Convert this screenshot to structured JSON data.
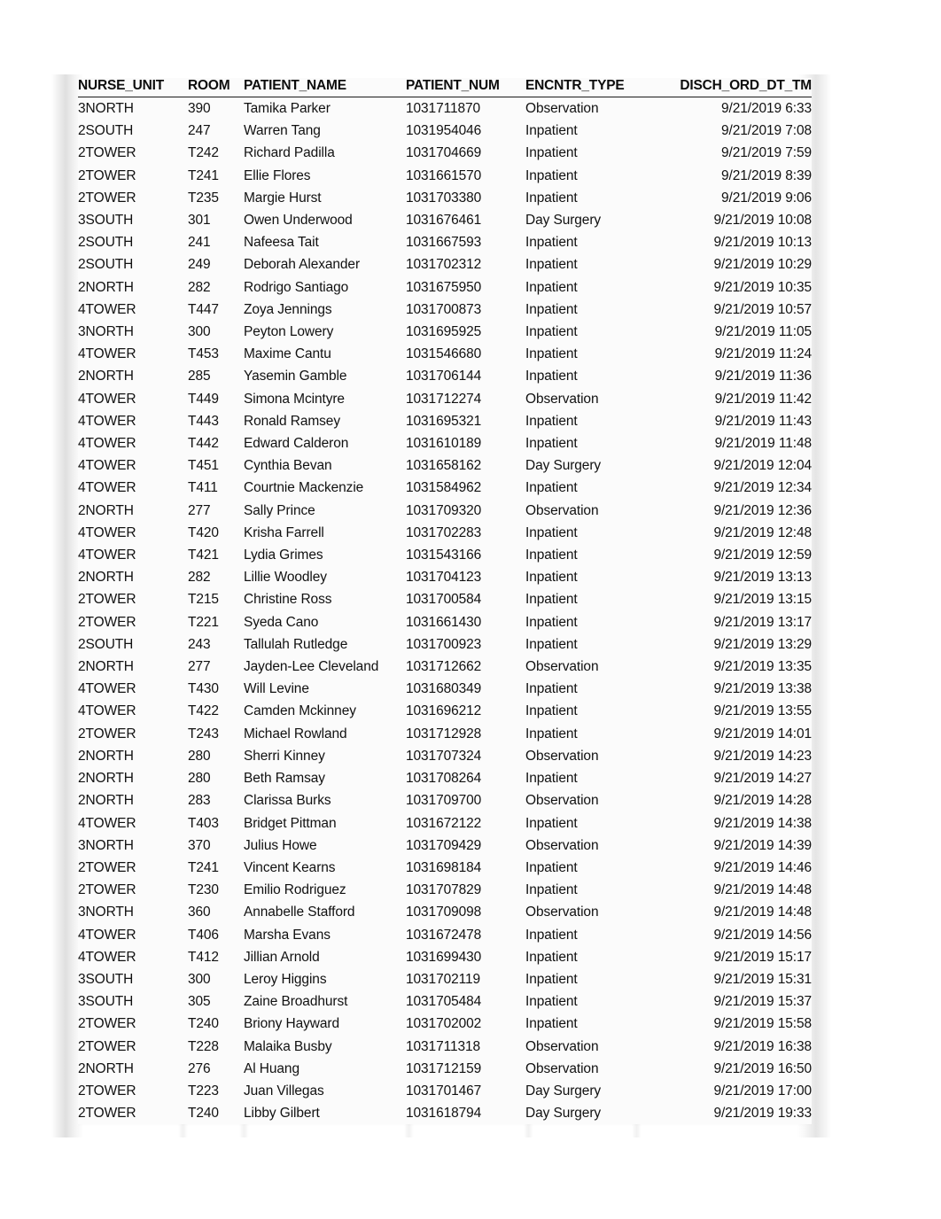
{
  "document": {
    "type": "spreadsheet-data-range",
    "colors": {
      "page_background": "#ffffff",
      "range_background": "#fbfbfb",
      "text": "#111111",
      "header_text": "#0d0d0d",
      "header_rule": "#1a1a1a"
    }
  },
  "table": {
    "columns": [
      {
        "key": "nurse_unit",
        "label": "NURSE_UNIT",
        "align": "left"
      },
      {
        "key": "room",
        "label": "ROOM",
        "align": "left"
      },
      {
        "key": "patient_name",
        "label": "PATIENT_NAME",
        "align": "left"
      },
      {
        "key": "patient_num",
        "label": "PATIENT_NUM",
        "align": "left"
      },
      {
        "key": "encntr_type",
        "label": "ENCNTR_TYPE",
        "align": "left"
      },
      {
        "key": "disch_ord",
        "label": "DISCH_ORD_DT_TM",
        "align": "right"
      }
    ],
    "row_count": 46,
    "rows": [
      {
        "nurse_unit": "3NORTH",
        "room": "390",
        "patient_name": "Tamika Parker",
        "patient_num": "1031711870",
        "encntr_type": "Observation",
        "disch_ord": "9/21/2019 6:33"
      },
      {
        "nurse_unit": "2SOUTH",
        "room": "247",
        "patient_name": "Warren Tang",
        "patient_num": "1031954046",
        "encntr_type": "Inpatient",
        "disch_ord": "9/21/2019 7:08"
      },
      {
        "nurse_unit": "2TOWER",
        "room": "T242",
        "patient_name": "Richard Padilla",
        "patient_num": "1031704669",
        "encntr_type": "Inpatient",
        "disch_ord": "9/21/2019 7:59"
      },
      {
        "nurse_unit": "2TOWER",
        "room": "T241",
        "patient_name": "Ellie Flores",
        "patient_num": "1031661570",
        "encntr_type": "Inpatient",
        "disch_ord": "9/21/2019 8:39"
      },
      {
        "nurse_unit": "2TOWER",
        "room": "T235",
        "patient_name": "Margie Hurst",
        "patient_num": "1031703380",
        "encntr_type": "Inpatient",
        "disch_ord": "9/21/2019 9:06"
      },
      {
        "nurse_unit": "3SOUTH",
        "room": "301",
        "patient_name": "Owen Underwood",
        "patient_num": "1031676461",
        "encntr_type": "Day Surgery",
        "disch_ord": "9/21/2019 10:08"
      },
      {
        "nurse_unit": "2SOUTH",
        "room": "241",
        "patient_name": "Nafeesa Tait",
        "patient_num": "1031667593",
        "encntr_type": "Inpatient",
        "disch_ord": "9/21/2019 10:13"
      },
      {
        "nurse_unit": "2SOUTH",
        "room": "249",
        "patient_name": "Deborah Alexander",
        "patient_num": "1031702312",
        "encntr_type": "Inpatient",
        "disch_ord": "9/21/2019 10:29"
      },
      {
        "nurse_unit": "2NORTH",
        "room": "282",
        "patient_name": "Rodrigo Santiago",
        "patient_num": "1031675950",
        "encntr_type": "Inpatient",
        "disch_ord": "9/21/2019 10:35"
      },
      {
        "nurse_unit": "4TOWER",
        "room": "T447",
        "patient_name": "Zoya Jennings",
        "patient_num": "1031700873",
        "encntr_type": "Inpatient",
        "disch_ord": "9/21/2019 10:57"
      },
      {
        "nurse_unit": "3NORTH",
        "room": "300",
        "patient_name": "Peyton Lowery",
        "patient_num": "1031695925",
        "encntr_type": "Inpatient",
        "disch_ord": "9/21/2019 11:05"
      },
      {
        "nurse_unit": "4TOWER",
        "room": "T453",
        "patient_name": "Maxime Cantu",
        "patient_num": "1031546680",
        "encntr_type": "Inpatient",
        "disch_ord": "9/21/2019 11:24"
      },
      {
        "nurse_unit": "2NORTH",
        "room": "285",
        "patient_name": "Yasemin Gamble",
        "patient_num": "1031706144",
        "encntr_type": "Inpatient",
        "disch_ord": "9/21/2019 11:36"
      },
      {
        "nurse_unit": "4TOWER",
        "room": "T449",
        "patient_name": "Simona Mcintyre",
        "patient_num": "1031712274",
        "encntr_type": "Observation",
        "disch_ord": "9/21/2019 11:42"
      },
      {
        "nurse_unit": "4TOWER",
        "room": "T443",
        "patient_name": "Ronald Ramsey",
        "patient_num": "1031695321",
        "encntr_type": "Inpatient",
        "disch_ord": "9/21/2019 11:43"
      },
      {
        "nurse_unit": "4TOWER",
        "room": "T442",
        "patient_name": "Edward Calderon",
        "patient_num": "1031610189",
        "encntr_type": "Inpatient",
        "disch_ord": "9/21/2019 11:48"
      },
      {
        "nurse_unit": "4TOWER",
        "room": "T451",
        "patient_name": "Cynthia Bevan",
        "patient_num": "1031658162",
        "encntr_type": "Day Surgery",
        "disch_ord": "9/21/2019 12:04"
      },
      {
        "nurse_unit": "4TOWER",
        "room": "T411",
        "patient_name": "Courtnie Mackenzie",
        "patient_num": "1031584962",
        "encntr_type": "Inpatient",
        "disch_ord": "9/21/2019 12:34"
      },
      {
        "nurse_unit": "2NORTH",
        "room": "277",
        "patient_name": "Sally Prince",
        "patient_num": "1031709320",
        "encntr_type": "Observation",
        "disch_ord": "9/21/2019 12:36"
      },
      {
        "nurse_unit": "4TOWER",
        "room": "T420",
        "patient_name": "Krisha Farrell",
        "patient_num": "1031702283",
        "encntr_type": "Inpatient",
        "disch_ord": "9/21/2019 12:48"
      },
      {
        "nurse_unit": "4TOWER",
        "room": "T421",
        "patient_name": "Lydia Grimes",
        "patient_num": "1031543166",
        "encntr_type": "Inpatient",
        "disch_ord": "9/21/2019 12:59"
      },
      {
        "nurse_unit": "2NORTH",
        "room": "282",
        "patient_name": "Lillie Woodley",
        "patient_num": "1031704123",
        "encntr_type": "Inpatient",
        "disch_ord": "9/21/2019 13:13"
      },
      {
        "nurse_unit": "2TOWER",
        "room": "T215",
        "patient_name": "Christine Ross",
        "patient_num": "1031700584",
        "encntr_type": "Inpatient",
        "disch_ord": "9/21/2019 13:15"
      },
      {
        "nurse_unit": "2TOWER",
        "room": "T221",
        "patient_name": "Syeda Cano",
        "patient_num": "1031661430",
        "encntr_type": "Inpatient",
        "disch_ord": "9/21/2019 13:17"
      },
      {
        "nurse_unit": "2SOUTH",
        "room": "243",
        "patient_name": "Tallulah Rutledge",
        "patient_num": "1031700923",
        "encntr_type": "Inpatient",
        "disch_ord": "9/21/2019 13:29"
      },
      {
        "nurse_unit": "2NORTH",
        "room": "277",
        "patient_name": "Jayden-Lee Cleveland",
        "patient_num": "1031712662",
        "encntr_type": "Observation",
        "disch_ord": "9/21/2019 13:35"
      },
      {
        "nurse_unit": "4TOWER",
        "room": "T430",
        "patient_name": "Will Levine",
        "patient_num": "1031680349",
        "encntr_type": "Inpatient",
        "disch_ord": "9/21/2019 13:38"
      },
      {
        "nurse_unit": "4TOWER",
        "room": "T422",
        "patient_name": "Camden Mckinney",
        "patient_num": "1031696212",
        "encntr_type": "Inpatient",
        "disch_ord": "9/21/2019 13:55"
      },
      {
        "nurse_unit": "2TOWER",
        "room": "T243",
        "patient_name": "Michael Rowland",
        "patient_num": "1031712928",
        "encntr_type": "Inpatient",
        "disch_ord": "9/21/2019 14:01"
      },
      {
        "nurse_unit": "2NORTH",
        "room": "280",
        "patient_name": "Sherri Kinney",
        "patient_num": "1031707324",
        "encntr_type": "Observation",
        "disch_ord": "9/21/2019 14:23"
      },
      {
        "nurse_unit": "2NORTH",
        "room": "280",
        "patient_name": "Beth Ramsay",
        "patient_num": "1031708264",
        "encntr_type": "Inpatient",
        "disch_ord": "9/21/2019 14:27"
      },
      {
        "nurse_unit": "2NORTH",
        "room": "283",
        "patient_name": "Clarissa Burks",
        "patient_num": "1031709700",
        "encntr_type": "Observation",
        "disch_ord": "9/21/2019 14:28"
      },
      {
        "nurse_unit": "4TOWER",
        "room": "T403",
        "patient_name": "Bridget Pittman",
        "patient_num": "1031672122",
        "encntr_type": "Inpatient",
        "disch_ord": "9/21/2019 14:38"
      },
      {
        "nurse_unit": "3NORTH",
        "room": "370",
        "patient_name": "Julius Howe",
        "patient_num": "1031709429",
        "encntr_type": "Observation",
        "disch_ord": "9/21/2019 14:39"
      },
      {
        "nurse_unit": "2TOWER",
        "room": "T241",
        "patient_name": "Vincent Kearns",
        "patient_num": "1031698184",
        "encntr_type": "Inpatient",
        "disch_ord": "9/21/2019 14:46"
      },
      {
        "nurse_unit": "2TOWER",
        "room": "T230",
        "patient_name": "Emilio Rodriguez",
        "patient_num": "1031707829",
        "encntr_type": "Inpatient",
        "disch_ord": "9/21/2019 14:48"
      },
      {
        "nurse_unit": "3NORTH",
        "room": "360",
        "patient_name": "Annabelle Stafford",
        "patient_num": "1031709098",
        "encntr_type": "Observation",
        "disch_ord": "9/21/2019 14:48"
      },
      {
        "nurse_unit": "4TOWER",
        "room": "T406",
        "patient_name": "Marsha Evans",
        "patient_num": "1031672478",
        "encntr_type": "Inpatient",
        "disch_ord": "9/21/2019 14:56"
      },
      {
        "nurse_unit": "4TOWER",
        "room": "T412",
        "patient_name": "Jillian Arnold",
        "patient_num": "1031699430",
        "encntr_type": "Inpatient",
        "disch_ord": "9/21/2019 15:17"
      },
      {
        "nurse_unit": "3SOUTH",
        "room": "300",
        "patient_name": "Leroy Higgins",
        "patient_num": "1031702119",
        "encntr_type": "Inpatient",
        "disch_ord": "9/21/2019 15:31"
      },
      {
        "nurse_unit": "3SOUTH",
        "room": "305",
        "patient_name": "Zaine Broadhurst",
        "patient_num": "1031705484",
        "encntr_type": "Inpatient",
        "disch_ord": "9/21/2019 15:37"
      },
      {
        "nurse_unit": "2TOWER",
        "room": "T240",
        "patient_name": "Briony Hayward",
        "patient_num": "1031702002",
        "encntr_type": "Inpatient",
        "disch_ord": "9/21/2019 15:58"
      },
      {
        "nurse_unit": "2TOWER",
        "room": "T228",
        "patient_name": "Malaika Busby",
        "patient_num": "1031711318",
        "encntr_type": "Observation",
        "disch_ord": "9/21/2019 16:38"
      },
      {
        "nurse_unit": "2NORTH",
        "room": "276",
        "patient_name": "Al Huang",
        "patient_num": "1031712159",
        "encntr_type": "Observation",
        "disch_ord": "9/21/2019 16:50"
      },
      {
        "nurse_unit": "2TOWER",
        "room": "T223",
        "patient_name": "Juan Villegas",
        "patient_num": "1031701467",
        "encntr_type": "Day Surgery",
        "disch_ord": "9/21/2019 17:00"
      },
      {
        "nurse_unit": "2TOWER",
        "room": "T240",
        "patient_name": "Libby Gilbert",
        "patient_num": "1031618794",
        "encntr_type": "Day Surgery",
        "disch_ord": "9/21/2019 19:33"
      }
    ]
  }
}
